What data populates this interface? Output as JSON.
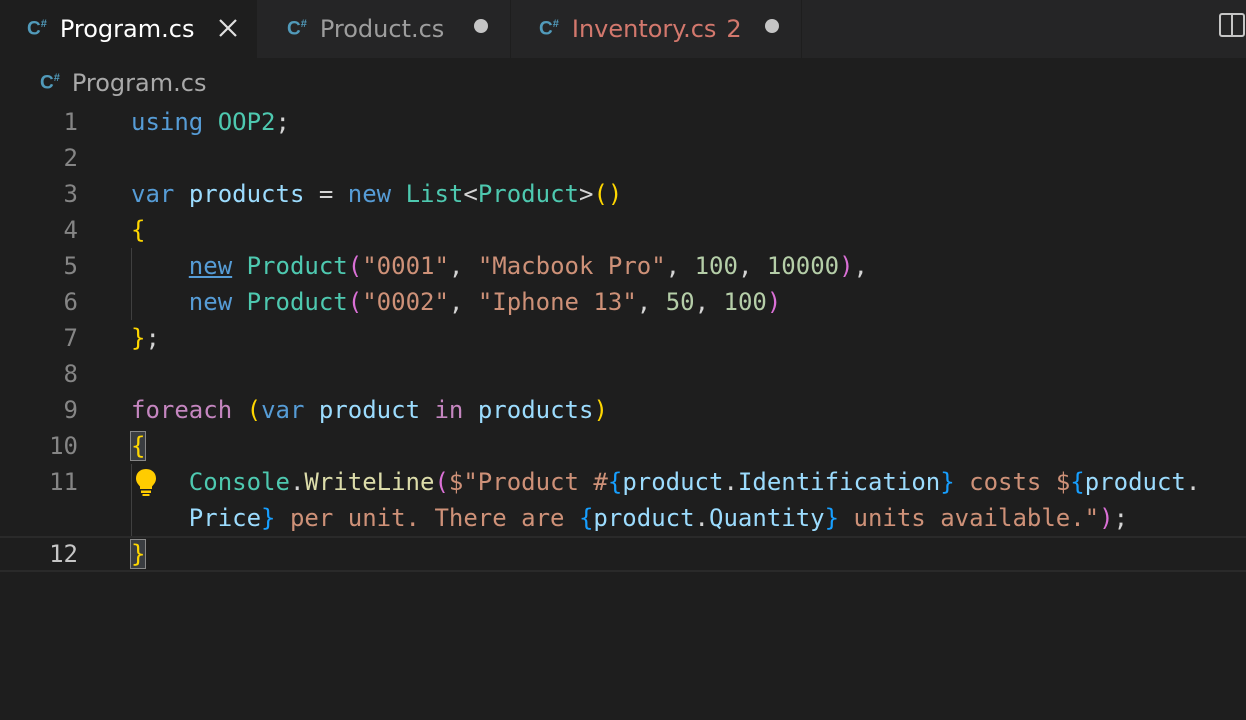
{
  "tabs": [
    {
      "label": "Program.cs",
      "icon": "csharp-file-icon",
      "active": true
    },
    {
      "label": "Product.cs",
      "icon": "csharp-file-icon",
      "modified": true
    },
    {
      "label": "Inventory.cs",
      "icon": "csharp-file-icon",
      "problems": "2",
      "modified": true
    }
  ],
  "breadcrumb": {
    "file": "Program.cs"
  },
  "editor": {
    "line_numbers": [
      "1",
      "2",
      "3",
      "4",
      "5",
      "6",
      "7",
      "8",
      "9",
      "10",
      "11",
      "",
      "12"
    ],
    "current_line": "12",
    "lines": [
      [
        [
          "kw",
          "using"
        ],
        [
          "pn",
          " "
        ],
        [
          "ty",
          "OOP2"
        ],
        [
          "pn",
          ";"
        ]
      ],
      [],
      [
        [
          "kw",
          "var"
        ],
        [
          "pn",
          " "
        ],
        [
          "var",
          "products"
        ],
        [
          "pn",
          " = "
        ],
        [
          "kw",
          "new"
        ],
        [
          "pn",
          " "
        ],
        [
          "ty",
          "List"
        ],
        [
          "pn",
          "<"
        ],
        [
          "ty",
          "Product"
        ],
        [
          "pn",
          ">"
        ],
        [
          "b1",
          "()"
        ]
      ],
      [
        [
          "b1",
          "{"
        ]
      ],
      [
        [
          "pn",
          "    "
        ],
        [
          "kw ul",
          "new"
        ],
        [
          "pn",
          " "
        ],
        [
          "ty",
          "Product"
        ],
        [
          "b2",
          "("
        ],
        [
          "str",
          "\"0001\""
        ],
        [
          "pn",
          ", "
        ],
        [
          "str",
          "\"Macbook Pro\""
        ],
        [
          "pn",
          ", "
        ],
        [
          "num",
          "100"
        ],
        [
          "pn",
          ", "
        ],
        [
          "num",
          "10000"
        ],
        [
          "b2",
          ")"
        ],
        [
          "pn",
          ","
        ]
      ],
      [
        [
          "pn",
          "    "
        ],
        [
          "kw",
          "new"
        ],
        [
          "pn",
          " "
        ],
        [
          "ty",
          "Product"
        ],
        [
          "b2",
          "("
        ],
        [
          "str",
          "\"0002\""
        ],
        [
          "pn",
          ", "
        ],
        [
          "str",
          "\"Iphone 13\""
        ],
        [
          "pn",
          ", "
        ],
        [
          "num",
          "50"
        ],
        [
          "pn",
          ", "
        ],
        [
          "num",
          "100"
        ],
        [
          "b2",
          ")"
        ]
      ],
      [
        [
          "b1",
          "}"
        ],
        [
          "pn",
          ";"
        ]
      ],
      [],
      [
        [
          "ctl",
          "foreach"
        ],
        [
          "pn",
          " "
        ],
        [
          "b1",
          "("
        ],
        [
          "kw",
          "var"
        ],
        [
          "pn",
          " "
        ],
        [
          "var",
          "product"
        ],
        [
          "pn",
          " "
        ],
        [
          "ctl",
          "in"
        ],
        [
          "pn",
          " "
        ],
        [
          "var",
          "products"
        ],
        [
          "b1",
          ")"
        ]
      ],
      [
        [
          "b1 matchbr",
          "{"
        ]
      ],
      [
        [
          "pn",
          "    "
        ],
        [
          "ty",
          "Console"
        ],
        [
          "pn",
          "."
        ],
        [
          "fn",
          "WriteLine"
        ],
        [
          "b2",
          "("
        ],
        [
          "str",
          "$\"Product #"
        ],
        [
          "b3",
          "{"
        ],
        [
          "var",
          "product"
        ],
        [
          "pn",
          "."
        ],
        [
          "var",
          "Identification"
        ],
        [
          "b3",
          "}"
        ],
        [
          "str",
          " costs $"
        ],
        [
          "b3",
          "{"
        ],
        [
          "var",
          "product"
        ],
        [
          "pn",
          "."
        ]
      ],
      [
        [
          "pn",
          "    "
        ],
        [
          "var",
          "Price"
        ],
        [
          "b3",
          "}"
        ],
        [
          "str",
          " per unit. There are "
        ],
        [
          "b3",
          "{"
        ],
        [
          "var",
          "product"
        ],
        [
          "pn",
          "."
        ],
        [
          "var",
          "Quantity"
        ],
        [
          "b3",
          "}"
        ],
        [
          "str",
          " units available.\""
        ],
        [
          "b2",
          ")"
        ],
        [
          "pn",
          ";"
        ]
      ],
      [
        [
          "b1 matchbr",
          "}"
        ]
      ]
    ]
  }
}
